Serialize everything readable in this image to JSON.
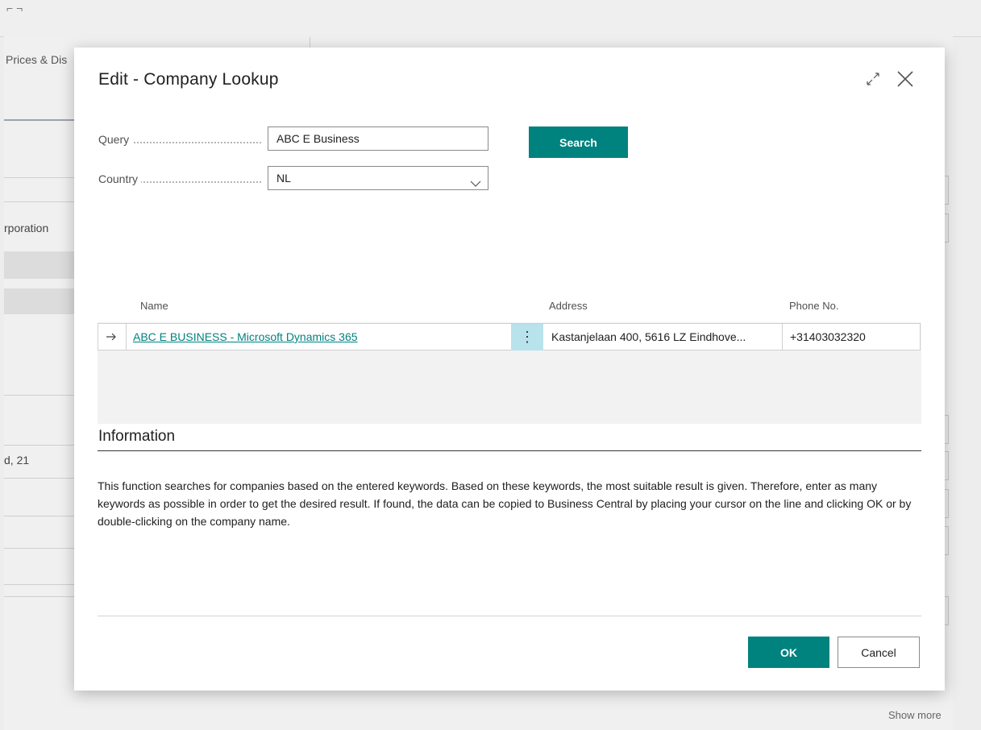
{
  "background": {
    "tab_label": "Prices & Dis",
    "field_fragment_1": "rporation",
    "field_fragment_2": "d, 21",
    "show_more": "Show more"
  },
  "dialog": {
    "title": "Edit - Company Lookup",
    "query": {
      "label": "Query",
      "value": "ABC E Business"
    },
    "country": {
      "label": "Country",
      "value": "NL"
    },
    "search_label": "Search",
    "grid": {
      "headers": {
        "name": "Name",
        "address": "Address",
        "phone": "Phone No."
      },
      "rows": [
        {
          "name": "ABC E BUSINESS - Microsoft Dynamics 365",
          "address": "Kastanjelaan 400, 5616 LZ Eindhove...",
          "phone": "+31403032320"
        }
      ]
    },
    "information": {
      "title": "Information",
      "text": "This function searches for companies based on the entered keywords. Based on these keywords, the most suitable result is given. Therefore, enter as many keywords as possible in order to get the desired result. If found, the data can be copied to Business Central by placing your cursor on the line and clicking OK or by double-clicking on the company name."
    },
    "ok_label": "OK",
    "cancel_label": "Cancel"
  },
  "colors": {
    "accent": "#00827f",
    "row_menu": "#b8e2ec"
  },
  "icons": [
    "expand-icon",
    "close-icon",
    "chevron-down-icon",
    "arrow-right-icon",
    "more-options-icon"
  ]
}
